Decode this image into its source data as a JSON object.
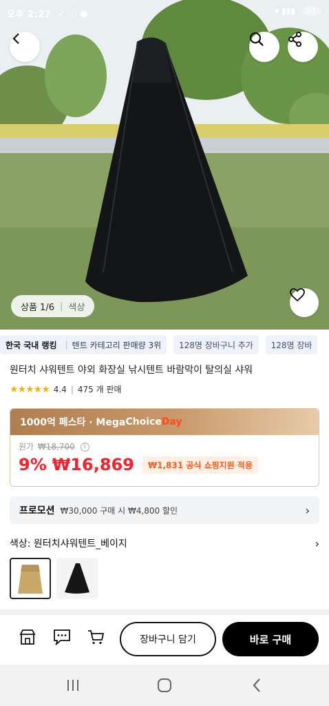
{
  "status": {
    "time": "오후 2:27",
    "battery": "91"
  },
  "hero": {
    "counter": "상품 1/6",
    "option_label": "색상"
  },
  "ranking": {
    "title": "한국 국내 랭킹",
    "category_text": "텐트 카테고리 판매량 3위",
    "cart_add_1": "128명 장바구니 추가",
    "cart_add_2": "128명 장바"
  },
  "product": {
    "title": "원터치 샤워텐트 야외 화장실 낚시텐트 바람막이 탈의실 샤워",
    "rating": "4.4",
    "sales": "475 개 판매",
    "rating_value": 4.4
  },
  "price": {
    "banner_left": "1000억 페스타 · Mega ",
    "banner_choice": "Choice",
    "banner_day": "Day",
    "original_label": "원가",
    "original_price": "₩18,700",
    "info": "i",
    "discount": "9%",
    "sale_price": "₩16,869",
    "support_badge": "₩1,831 공식 쇼핑지원 적용"
  },
  "promotion": {
    "label": "프로모션",
    "text": "₩30,000 구매 시 ₩4,800 할인"
  },
  "options": {
    "label": "색상: 원터치샤워텐트_베이지"
  },
  "actions": {
    "cart_label": "장바구니 담기",
    "buy_label": "바로 구매"
  },
  "icons": [
    "back-icon",
    "search-icon",
    "share-icon",
    "heart-icon",
    "store-icon",
    "chat-icon",
    "cart-icon",
    "recent-apps-icon",
    "home-icon",
    "nav-back-icon"
  ],
  "colors": {
    "price_red": "#ff1f2a",
    "banner_gold": "#c99a6c",
    "buy_black": "#000000"
  }
}
